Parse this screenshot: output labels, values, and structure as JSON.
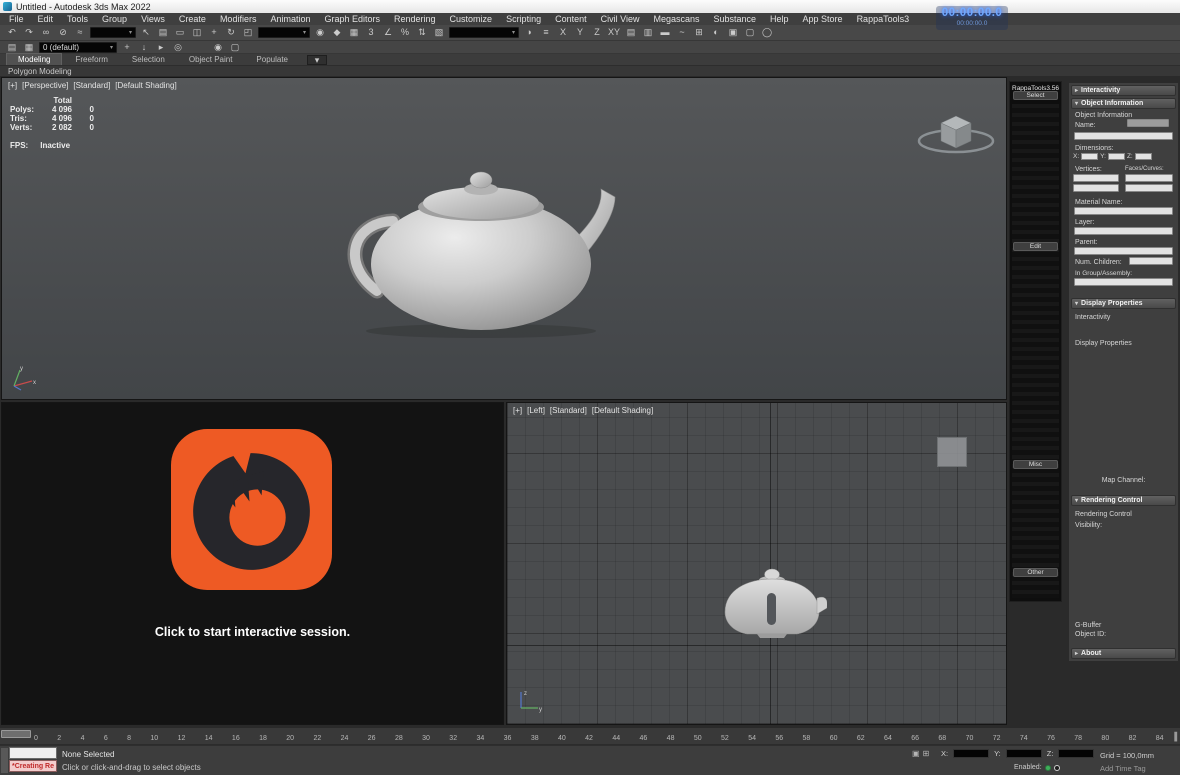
{
  "window": {
    "title": "Untitled - Autodesk 3ds Max 2022"
  },
  "timer": {
    "main": "00:00:00.0",
    "sub": "00:00:00.0"
  },
  "menu": {
    "items": [
      "File",
      "Edit",
      "Tools",
      "Group",
      "Views",
      "Create",
      "Modifiers",
      "Animation",
      "Graph Editors",
      "Rendering",
      "Customize",
      "Scripting",
      "Content",
      "Civil View",
      "Megascans",
      "Substance",
      "Help",
      "App Store",
      "RappaTools3"
    ]
  },
  "toolbar": {
    "row1": {
      "segA": [
        {
          "name": "undo-icon",
          "glyph": "↶"
        },
        {
          "name": "redo-icon",
          "glyph": "↷"
        },
        {
          "name": "select-link-icon",
          "glyph": "∞"
        },
        {
          "name": "unlink-selection-icon",
          "glyph": "⊘"
        },
        {
          "name": "bind-spacewarp-icon",
          "glyph": "≈"
        }
      ],
      "filter_dropdown": "",
      "segB": [
        {
          "name": "select-object-icon",
          "glyph": "↖"
        },
        {
          "name": "select-by-name-icon",
          "glyph": "▤"
        },
        {
          "name": "selection-region-icon",
          "glyph": "▭"
        },
        {
          "name": "window-crossing-icon",
          "glyph": "◫"
        },
        {
          "name": "select-move-icon",
          "glyph": "+"
        },
        {
          "name": "select-rotate-icon",
          "glyph": "↻"
        },
        {
          "name": "select-scale-icon",
          "glyph": "◰"
        }
      ],
      "coord_dropdown": "",
      "segC": [
        {
          "name": "use-pivot-icon",
          "glyph": "◉"
        },
        {
          "name": "select-manipulate-icon",
          "glyph": "◆"
        },
        {
          "name": "keyboard-override-icon",
          "glyph": "▦"
        },
        {
          "name": "snap-toggle-icon",
          "glyph": "3"
        },
        {
          "name": "angle-snap-icon",
          "glyph": "∠"
        },
        {
          "name": "percent-snap-icon",
          "glyph": "%"
        },
        {
          "name": "spinner-snap-icon",
          "glyph": "⇅"
        },
        {
          "name": "named-selection-edit-icon",
          "glyph": "▧"
        }
      ],
      "named_dropdown": "",
      "segD": [
        {
          "name": "mirror-icon",
          "glyph": "◑"
        },
        {
          "name": "align-icon",
          "glyph": "≡"
        },
        {
          "name": "axis-x-icon",
          "glyph": "X"
        },
        {
          "name": "axis-y-icon",
          "glyph": "Y"
        },
        {
          "name": "axis-z-icon",
          "glyph": "Z"
        },
        {
          "name": "axis-xy-icon",
          "glyph": "XY"
        },
        {
          "name": "scene-explorer-icon",
          "glyph": "▤"
        },
        {
          "name": "layer-explorer-icon",
          "glyph": "▥"
        },
        {
          "name": "ribbon-toggle-icon",
          "glyph": "▬"
        },
        {
          "name": "curve-editor-icon",
          "glyph": "~"
        },
        {
          "name": "schematic-view-icon",
          "glyph": "⊞"
        },
        {
          "name": "material-editor-icon",
          "glyph": "◐"
        },
        {
          "name": "render-setup-icon",
          "glyph": "▣"
        },
        {
          "name": "rendered-frame-icon",
          "glyph": "▢"
        },
        {
          "name": "render-production-icon",
          "glyph": "◯"
        }
      ]
    },
    "row2": {
      "segA": [
        {
          "name": "scene-explorer-toggle-icon",
          "glyph": "▤"
        },
        {
          "name": "layer-manager-icon",
          "glyph": "▦"
        }
      ],
      "layer_dropdown": "0 (default)",
      "segB": [
        {
          "name": "create-layer-icon",
          "glyph": "+"
        },
        {
          "name": "add-to-layer-icon",
          "glyph": "↓"
        },
        {
          "name": "select-in-layer-icon",
          "glyph": "▸"
        },
        {
          "name": "current-layer-icon",
          "glyph": "◎"
        }
      ],
      "segC": [
        {
          "name": "isolate-selection-icon",
          "glyph": "◉"
        },
        {
          "name": "display-floater-icon",
          "glyph": "▢"
        }
      ]
    }
  },
  "ribbon": {
    "tabs": [
      "Modeling",
      "Freeform",
      "Selection",
      "Object Paint",
      "Populate"
    ],
    "minimize_glyph": "▾",
    "panel": "Polygon Modeling"
  },
  "viewports": {
    "perspective": {
      "labels": [
        "[+]",
        "[Perspective]",
        "[Standard]",
        "[Default Shading]"
      ],
      "stats": {
        "header": "Total",
        "rows": [
          {
            "label": "Polys:",
            "total": "4 096",
            "sel": "0"
          },
          {
            "label": "Tris:",
            "total": "4 096",
            "sel": "0"
          },
          {
            "label": "Verts:",
            "total": "2 082",
            "sel": "0"
          }
        ],
        "fps_label": "FPS:",
        "fps_value": "Inactive"
      }
    },
    "corona": {
      "message": "Click to start interactive session."
    },
    "left": {
      "labels": [
        "[+]",
        "[Left]",
        "[Standard]",
        "[Default Shading]"
      ]
    }
  },
  "rappatools": {
    "title": "RappaTools3.56",
    "buttons": {
      "select": "Select",
      "edit": "Edit",
      "misc": "Misc",
      "other": "Other"
    }
  },
  "right_panel": {
    "interactivity_header": "Interactivity",
    "object_information": {
      "header": "Object Information",
      "section_label": "Object Information",
      "name_label": "Name:",
      "dimensions_label": "Dimensions:",
      "x_label": "X:",
      "y_label": "Y:",
      "z_label": "Z:",
      "vertices_label": "Vertices:",
      "faces_label": "Faces/Curves:",
      "material_label": "Material Name:",
      "layer_label": "Layer:",
      "parent_label": "Parent:",
      "children_label": "Num. Children:",
      "group_label": "In Group/Assembly:"
    },
    "display_properties": {
      "header": "Display Properties",
      "interactivity_label": "Interactivity",
      "display_label": "Display Properties",
      "map_channel_label": "Map Channel:"
    },
    "rendering_control": {
      "header": "Rendering Control",
      "section_label": "Rendering Control",
      "visibility_label": "Visibility:",
      "gbuffer_label": "G-Buffer",
      "objectid_label": "Object ID:"
    },
    "about_header": "About"
  },
  "timeline": {
    "ticks": [
      "0",
      "2",
      "4",
      "6",
      "8",
      "10",
      "12",
      "14",
      "16",
      "18",
      "20",
      "22",
      "24",
      "26",
      "28",
      "30",
      "32",
      "34",
      "36",
      "38",
      "40",
      "42",
      "44",
      "46",
      "48",
      "50",
      "52",
      "54",
      "56",
      "58",
      "60",
      "62",
      "64",
      "66",
      "68",
      "70",
      "72",
      "74",
      "76",
      "78",
      "80",
      "82",
      "84"
    ],
    "end_glyph": "▐"
  },
  "statusbar": {
    "listener_text": "*Creating Re",
    "selection_text": "None Selected",
    "prompt": "Click or click-and-drag to select objects",
    "lock_glyph": "▣",
    "absmode_glyph": "⊞",
    "x_label": "X:",
    "y_label": "Y:",
    "z_label": "Z:",
    "grid_text": "Grid = 100,0mm",
    "add_time_tag": "Add Time Tag",
    "enabled_label": "Enabled:"
  },
  "colors": {
    "corona_orange": "#ee5a24",
    "corona_dark": "#26262b",
    "timer_blue": "#6fa8ff",
    "listener_pink": "#f3cccc",
    "listener_red": "#c02a2a",
    "axis_x_red": "#c84b4b",
    "axis_y_green": "#63b063",
    "axis_z_blue": "#5577cc"
  }
}
